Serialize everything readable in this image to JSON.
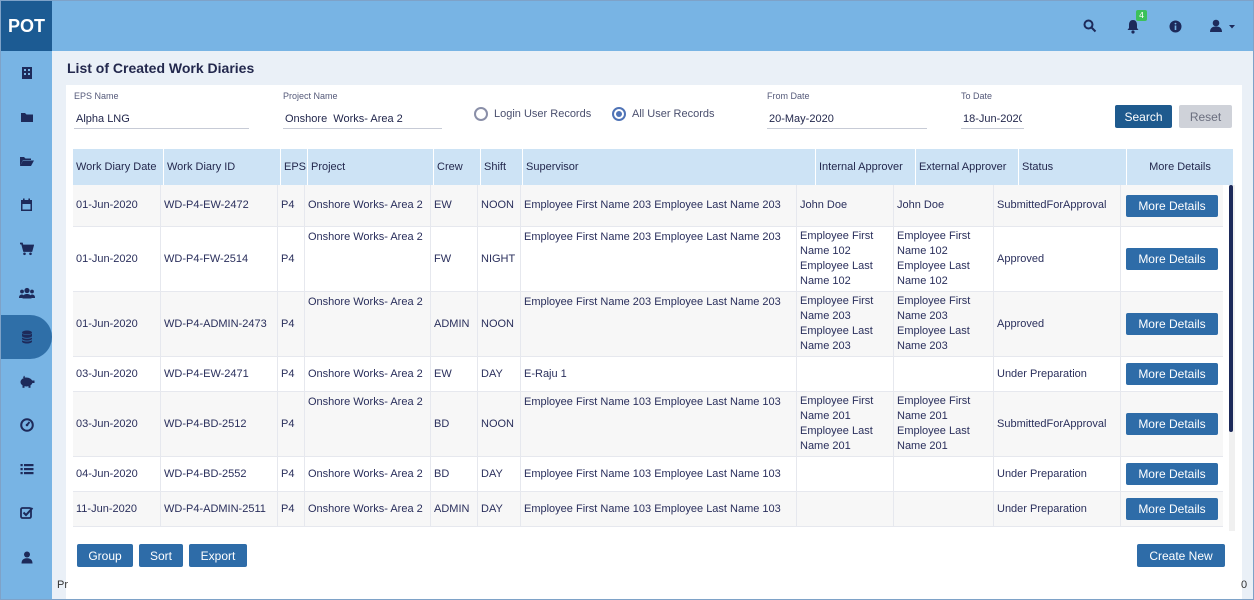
{
  "app": {
    "logo": "POT",
    "notification_count": "4"
  },
  "page": {
    "title": "List of Created Work Diaries"
  },
  "filters": {
    "eps_label": "EPS Name",
    "eps_value": "Alpha LNG",
    "project_label": "Project Name",
    "project_value": "Onshore  Works- Area 2",
    "radio_login": "Login User Records",
    "radio_all": "All User Records",
    "from_label": "From Date",
    "from_value": "20-May-2020",
    "to_label": "To Date",
    "to_value": "18-Jun-2020",
    "search_label": "Search",
    "reset_label": "Reset"
  },
  "table": {
    "headers": [
      "Work Diary Date",
      "Work Diary ID",
      "EPS",
      "Project",
      "Crew",
      "Shift",
      "Supervisor",
      "Internal Approver",
      "External Approver",
      "Status",
      "More Details"
    ],
    "more_label": "More Details",
    "rows": [
      {
        "date": "01-Jun-2020",
        "id": "WD-P4-EW-2472",
        "eps": "P4",
        "project": "Onshore Works- Area 2",
        "crew": "EW",
        "shift": "NOON",
        "supervisor": "Employee First Name 203 Employee Last Name 203",
        "internal": "John Doe",
        "external": "John Doe",
        "status": "SubmittedForApproval"
      },
      {
        "date": "01-Jun-2020",
        "id": "WD-P4-FW-2514",
        "eps": "P4",
        "project": "Onshore Works- Area 2",
        "crew": "FW",
        "shift": "NIGHT",
        "supervisor": "Employee First Name 203 Employee Last Name 203",
        "internal": "Employee First Name 102 Employee Last Name 102",
        "external": "Employee First Name 102 Employee Last Name 102",
        "status": "Approved"
      },
      {
        "date": "01-Jun-2020",
        "id": "WD-P4-ADMIN-2473",
        "eps": "P4",
        "project": "Onshore Works- Area 2",
        "crew": "ADMIN",
        "shift": "NOON",
        "supervisor": "Employee First Name 203 Employee Last Name 203",
        "internal": "Employee First Name 203 Employee Last Name 203",
        "external": "Employee First Name 203 Employee Last Name 203",
        "status": "Approved"
      },
      {
        "date": "03-Jun-2020",
        "id": "WD-P4-EW-2471",
        "eps": "P4",
        "project": "Onshore Works- Area 2",
        "crew": "EW",
        "shift": "DAY",
        "supervisor": "E-Raju 1",
        "internal": "",
        "external": "",
        "status": "Under Preparation"
      },
      {
        "date": "03-Jun-2020",
        "id": "WD-P4-BD-2512",
        "eps": "P4",
        "project": "Onshore Works- Area 2",
        "crew": "BD",
        "shift": "NOON",
        "supervisor": "Employee First Name 103 Employee Last Name 103",
        "internal": "Employee First Name 201 Employee Last Name 201",
        "external": "Employee First Name 201 Employee Last Name 201",
        "status": "SubmittedForApproval"
      },
      {
        "date": "04-Jun-2020",
        "id": "WD-P4-BD-2552",
        "eps": "P4",
        "project": "Onshore Works- Area 2",
        "crew": "BD",
        "shift": "DAY",
        "supervisor": "Employee First Name 103 Employee Last Name 103",
        "internal": "",
        "external": "",
        "status": "Under Preparation"
      },
      {
        "date": "11-Jun-2020",
        "id": "WD-P4-ADMIN-2511",
        "eps": "P4",
        "project": "Onshore Works- Area 2",
        "crew": "ADMIN",
        "shift": "DAY",
        "supervisor": "Employee First Name 103 Employee Last Name 103",
        "internal": "",
        "external": "",
        "status": "Under Preparation"
      }
    ]
  },
  "actions": {
    "group": "Group",
    "sort": "Sort",
    "export": "Export",
    "create_new": "Create New"
  },
  "footer": {
    "left_stub": "Pr",
    "right_stub": "0"
  }
}
